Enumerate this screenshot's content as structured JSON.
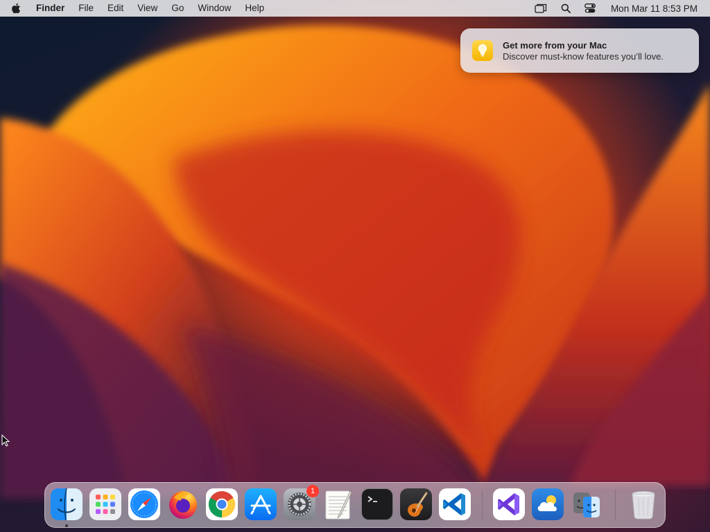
{
  "menubar": {
    "apple_icon": "apple-icon",
    "app_name": "Finder",
    "menus": [
      "File",
      "Edit",
      "View",
      "Go",
      "Window",
      "Help"
    ],
    "status_icons": [
      "screen-mirroring-icon",
      "spotlight-search-icon",
      "control-center-icon"
    ],
    "clock": "Mon Mar 11  8:53 PM"
  },
  "notification": {
    "icon": "lightbulb-icon",
    "title": "Get more from your Mac",
    "body": "Discover must-know features you’ll love."
  },
  "dock": {
    "apps": [
      {
        "name": "Finder",
        "icon": "finder-icon",
        "running": true
      },
      {
        "name": "Launchpad",
        "icon": "launchpad-icon"
      },
      {
        "name": "Safari",
        "icon": "safari-icon"
      },
      {
        "name": "Firefox",
        "icon": "firefox-icon"
      },
      {
        "name": "Google Chrome",
        "icon": "chrome-icon"
      },
      {
        "name": "App Store",
        "icon": "app-store-icon"
      },
      {
        "name": "System Settings",
        "icon": "system-settings-icon",
        "badge": "1"
      },
      {
        "name": "TextEdit",
        "icon": "textedit-icon"
      },
      {
        "name": "Terminal",
        "icon": "terminal-icon"
      },
      {
        "name": "GarageBand",
        "icon": "garageband-icon"
      },
      {
        "name": "Visual Studio Code",
        "icon": "vscode-icon"
      },
      {
        "name": "Visual Studio",
        "icon": "visual-studio-icon"
      },
      {
        "name": "Weather",
        "icon": "weather-icon"
      },
      {
        "name": "Migration Assistant",
        "icon": "migration-assistant-icon"
      },
      {
        "name": "Trash",
        "icon": "trash-icon"
      }
    ]
  },
  "colors": {
    "menubar_bg": "#ececee",
    "badge": "#ff3b30",
    "vscode_blue": "#0a66c2",
    "wallpaper_orange": "#e8541c",
    "wallpaper_navy": "#0f1a2c"
  }
}
